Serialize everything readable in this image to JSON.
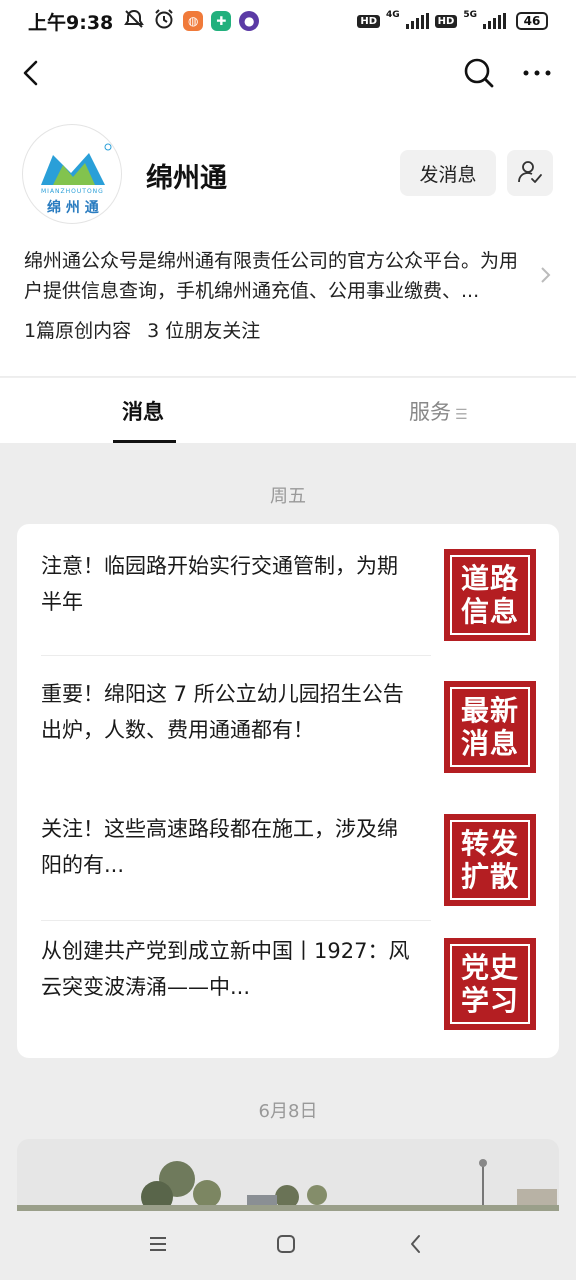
{
  "status_bar": {
    "time": "上午9:38",
    "icons": [
      "mute-icon",
      "alarm-icon",
      "app-notification-icons"
    ],
    "hd1": "HD",
    "net1": "4G",
    "hd2": "HD",
    "net2": "5G",
    "battery": "46"
  },
  "account": {
    "name": "绵州通",
    "logo_text": "绵 州 通",
    "logo_sub": "MIANZHOUTONG",
    "send_message_label": "发消息",
    "description": "绵州通公众号是绵州通有限责任公司的官方公众平台。为用户提供信息查询，手机绵州通充值、公用事业缴费、...",
    "original_count": "1篇原创内容",
    "friends_following": "3 位朋友关注"
  },
  "tabs": {
    "messages": "消息",
    "services": "服务"
  },
  "feed": {
    "date1": "周五",
    "articles": [
      {
        "title": "注意！临园路开始实行交通管制，为期半年",
        "thumb_text": "道路信息"
      },
      {
        "title": "重要！绵阳这 7 所公立幼儿园招生公告出炉，人数、费用通通都有！",
        "thumb_text": "最新消息"
      },
      {
        "title": "关注！这些高速路段都在施工，涉及绵阳的有...",
        "thumb_text": "转发扩散"
      },
      {
        "title": "从创建共产党到成立新中国丨1927：风云突变波涛涌——中...",
        "thumb_text": "党史学习"
      }
    ],
    "date2": "6月8日"
  },
  "colors": {
    "thumb_red": "#b41e22",
    "logo_blue": "#2a9fd8",
    "logo_green": "#8cc63f"
  }
}
